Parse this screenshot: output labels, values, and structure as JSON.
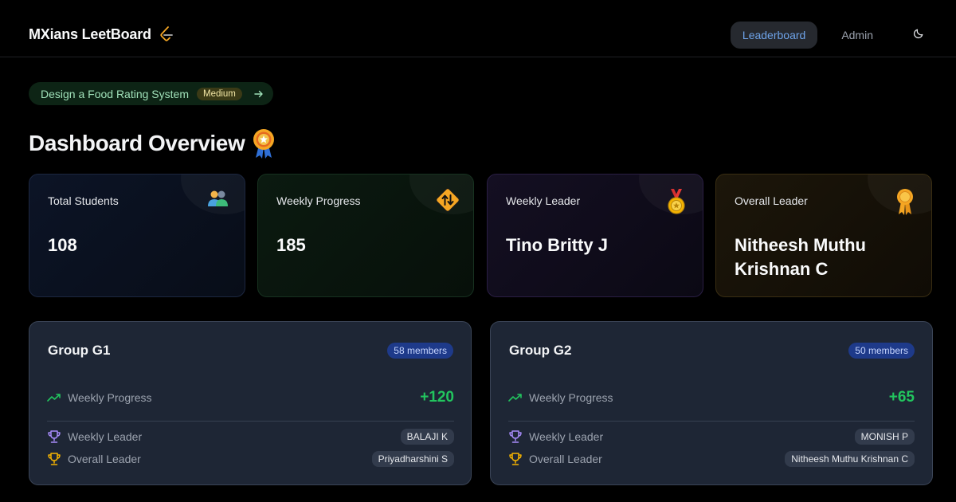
{
  "header": {
    "brand_title": "MXians LeetBoard",
    "nav": {
      "leaderboard": "Leaderboard",
      "admin": "Admin"
    }
  },
  "problem": {
    "title": "Design a Food Rating System",
    "difficulty": "Medium"
  },
  "page": {
    "title": "Dashboard Overview"
  },
  "stats": [
    {
      "label": "Total Students",
      "value": "108",
      "icon": "people-icon"
    },
    {
      "label": "Weekly Progress",
      "value": "185",
      "icon": "updown-arrow-sign-icon"
    },
    {
      "label": "Weekly Leader",
      "value": "Tino Britty J",
      "icon": "medal-icon"
    },
    {
      "label": "Overall Leader",
      "value": "Nitheesh Muthu Krishnan C",
      "icon": "rosette-icon"
    }
  ],
  "groups": [
    {
      "name": "Group G1",
      "members": "58 members",
      "progress_label": "Weekly Progress",
      "progress_value": "+120",
      "weekly_leader_label": "Weekly Leader",
      "weekly_leader": "BALAJI K",
      "overall_leader_label": "Overall Leader",
      "overall_leader": "Priyadharshini S"
    },
    {
      "name": "Group G2",
      "members": "50 members",
      "progress_label": "Weekly Progress",
      "progress_value": "+65",
      "weekly_leader_label": "Weekly Leader",
      "weekly_leader": "MONISH P",
      "overall_leader_label": "Overall Leader",
      "overall_leader": "Nitheesh Muthu Krishnan C"
    }
  ],
  "colors": {
    "accent_blue": "#6ea3e8",
    "progress_green": "#22c55e",
    "members_badge": "#1e3a8a",
    "trophy_purple": "#a78bfa",
    "trophy_gold": "#f5b301"
  }
}
